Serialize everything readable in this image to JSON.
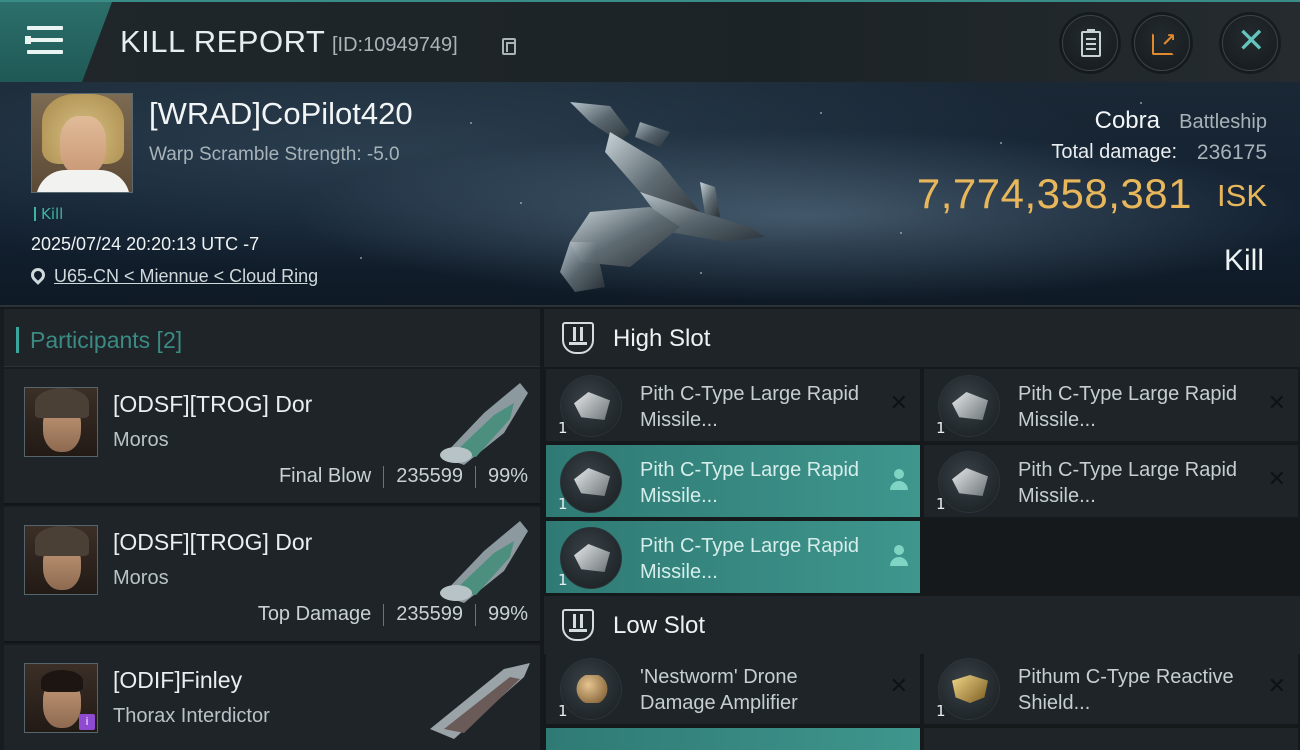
{
  "header": {
    "title": "KILL REPORT",
    "report_id": "[ID:10949749]"
  },
  "victim": {
    "name": "[WRAD]CoPilot420",
    "scram_text": "Warp Scramble Strength: -5.0",
    "tag": "Kill",
    "datetime": "2025/07/24 20:20:13 UTC -7",
    "location": "U65-CN < Miennue < Cloud Ring",
    "ship_name": "Cobra",
    "ship_class": "Battleship",
    "damage_label": "Total damage:",
    "damage_value": "236175",
    "isk_value": "7,774,358,381",
    "isk_unit": "ISK",
    "result": "Kill"
  },
  "participants": {
    "title": "Participants [2]",
    "rows": [
      {
        "name": "[ODSF][TROG] Dor",
        "ship": "Moros",
        "role": "Final Blow",
        "damage": "235599",
        "percent": "99%"
      },
      {
        "name": "[ODSF][TROG] Dor",
        "ship": "Moros",
        "role": "Top Damage",
        "damage": "235599",
        "percent": "99%"
      },
      {
        "name": "[ODIF]Finley",
        "ship": "Thorax Interdictor",
        "role": "",
        "damage": "",
        "percent": ""
      }
    ]
  },
  "fitting": {
    "high_slot_title": "High Slot",
    "low_slot_title": "Low Slot",
    "high": [
      {
        "name": "Pith C-Type Large Rapid Missile...",
        "qty": "1",
        "status": "destroyed"
      },
      {
        "name": "Pith C-Type Large Rapid Missile...",
        "qty": "1",
        "status": "destroyed"
      },
      {
        "name": "Pith C-Type Large Rapid Missile...",
        "qty": "1",
        "status": "dropped"
      },
      {
        "name": "Pith C-Type Large Rapid Missile...",
        "qty": "1",
        "status": "destroyed"
      },
      {
        "name": "Pith C-Type Large Rapid Missile...",
        "qty": "1",
        "status": "dropped"
      }
    ],
    "low": [
      {
        "name": "'Nestworm' Drone Damage Amplifier",
        "qty": "1",
        "status": "destroyed"
      },
      {
        "name": "Pithum C-Type Reactive Shield...",
        "qty": "1",
        "status": "destroyed"
      }
    ]
  },
  "icons": {
    "menu": "hamburger-menu-icon",
    "copy": "copy-icon",
    "clipboard": "clipboard-icon",
    "share": "share-icon",
    "close": "close-icon",
    "location": "location-pin-icon",
    "slot": "shield-slot-icon",
    "destroyed": "x-icon",
    "dropped": "person-icon"
  },
  "colors": {
    "accent": "#3aa79d",
    "isk": "#e8b75b",
    "dropped_bg": "#3e968d"
  }
}
